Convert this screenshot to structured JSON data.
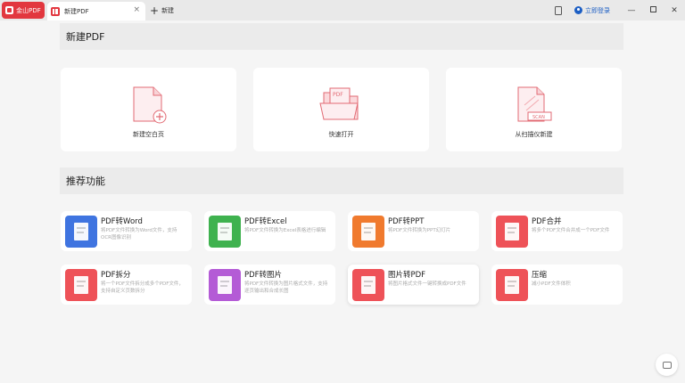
{
  "titlebar": {
    "brand_label": "金山PDF",
    "tab_label": "新建PDF",
    "tab_close": "×",
    "new_tab_label": "新建",
    "login_label": "立即登录",
    "minimize": "—",
    "close": "✕"
  },
  "new_pdf": {
    "heading": "新建PDF",
    "cards": [
      {
        "label": "新建空白页",
        "icon": "blank-page-plus-icon"
      },
      {
        "label": "快速打开",
        "icon": "folder-open-pdf-icon"
      },
      {
        "label": "从扫描仪新建",
        "icon": "scanner-page-icon"
      }
    ]
  },
  "recommended": {
    "heading": "推荐功能",
    "items": [
      {
        "title": "PDF转Word",
        "desc": "将PDF文件转换为Word文件，支持OCR图像识别",
        "color": "#3f74e0",
        "icon": "pdf-to-word-icon"
      },
      {
        "title": "PDF转Excel",
        "desc": "将PDF文件转换为Excel表格进行编辑",
        "color": "#3fb24f",
        "icon": "pdf-to-excel-icon"
      },
      {
        "title": "PDF转PPT",
        "desc": "将PDF文件转换为PPT幻灯片",
        "color": "#f07a2e",
        "icon": "pdf-to-ppt-icon"
      },
      {
        "title": "PDF合并",
        "desc": "将多个PDF文件合并成一个PDF文件",
        "color": "#ee5258",
        "icon": "pdf-merge-icon"
      },
      {
        "title": "PDF拆分",
        "desc": "将一个PDF文件拆分成多个PDF文件，支持自定义页数拆分",
        "color": "#ee5258",
        "icon": "pdf-split-icon"
      },
      {
        "title": "PDF转图片",
        "desc": "将PDF文件转换为图片格式文件，支持逐页输出和合成长图",
        "color": "#b45bd6",
        "icon": "pdf-to-image-icon"
      },
      {
        "title": "图片转PDF",
        "desc": "将图片格式文件一键转换成PDF文件",
        "color": "#ee5258",
        "icon": "image-to-pdf-icon"
      },
      {
        "title": "压缩",
        "desc": "减小PDF文件体积",
        "color": "#ee5258",
        "icon": "compress-icon"
      }
    ]
  },
  "illustrations": {
    "pdf_text": "PDF",
    "scan_text": "SCAN"
  }
}
